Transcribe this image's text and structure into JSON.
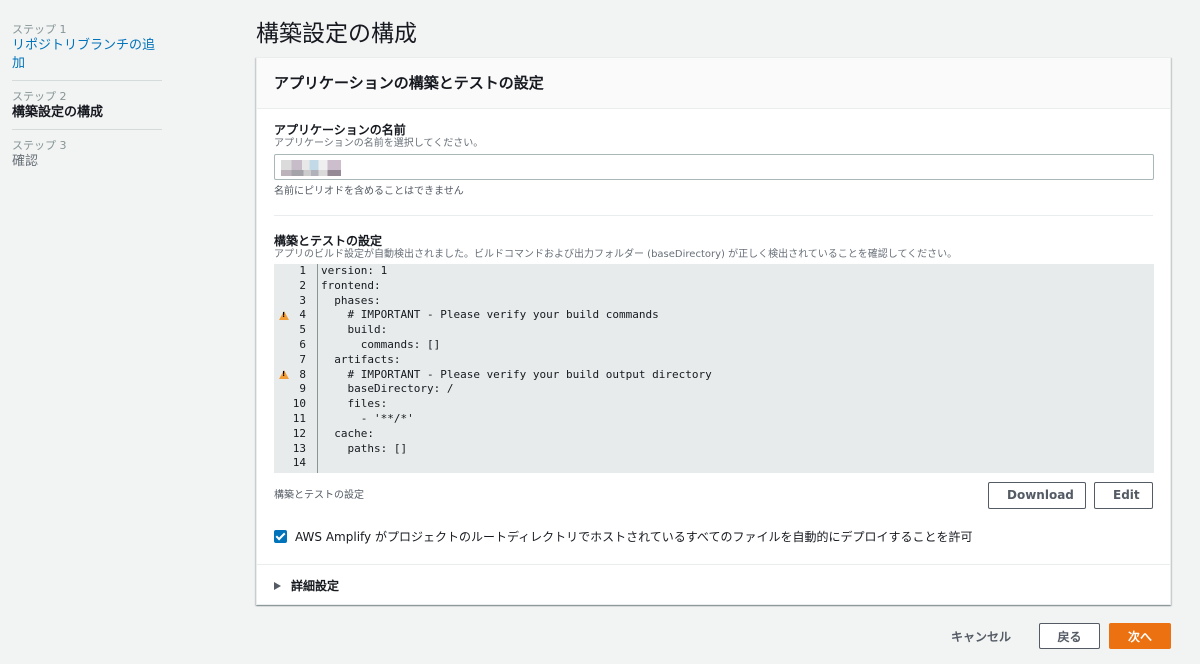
{
  "sidebar": {
    "steps": [
      {
        "num": "ステップ 1",
        "label": "リポジトリブランチの追加"
      },
      {
        "num": "ステップ 2",
        "label": "構築設定の構成"
      },
      {
        "num": "ステップ 3",
        "label": "確認"
      }
    ]
  },
  "page": {
    "title": "構築設定の構成"
  },
  "panel": {
    "header": "アプリケーションの構築とテストの設定",
    "app_name": {
      "label": "アプリケーションの名前",
      "description": "アプリケーションの名前を選択してください。",
      "hint": "名前にピリオドを含めることはできません"
    },
    "build": {
      "label": "構築とテストの設定",
      "description": "アプリのビルド設定が自動検出されました。ビルドコマンドおよび出力フォルダー (baseDirectory) が正しく検出されていることを確認してください。",
      "caption": "構築とテストの設定",
      "code_lines": [
        {
          "n": "1",
          "text": "version: 1",
          "warn": false
        },
        {
          "n": "2",
          "text": "frontend:",
          "warn": false
        },
        {
          "n": "3",
          "text": "  phases:",
          "warn": false
        },
        {
          "n": "4",
          "text": "    # IMPORTANT - Please verify your build commands",
          "warn": true
        },
        {
          "n": "5",
          "text": "    build:",
          "warn": false
        },
        {
          "n": "6",
          "text": "      commands: []",
          "warn": false
        },
        {
          "n": "7",
          "text": "  artifacts:",
          "warn": false
        },
        {
          "n": "8",
          "text": "    # IMPORTANT - Please verify your build output directory",
          "warn": true
        },
        {
          "n": "9",
          "text": "    baseDirectory: /",
          "warn": false
        },
        {
          "n": "10",
          "text": "    files:",
          "warn": false
        },
        {
          "n": "11",
          "text": "      - '**/*'",
          "warn": false
        },
        {
          "n": "12",
          "text": "  cache:",
          "warn": false
        },
        {
          "n": "13",
          "text": "    paths: []",
          "warn": false
        },
        {
          "n": "14",
          "text": "",
          "warn": false
        }
      ],
      "download_label": "Download",
      "edit_label": "Edit"
    },
    "checkbox": {
      "label": "AWS Amplify がプロジェクトのルートディレクトリでホストされているすべてのファイルを自動的にデプロイすることを許可",
      "checked": true
    },
    "advanced": "詳細設定"
  },
  "actions": {
    "cancel": "キャンセル",
    "back": "戻る",
    "next": "次へ"
  },
  "colors": {
    "accent": "#0073bb",
    "primary_button": "#ec7211",
    "warning": "#f29d36"
  }
}
